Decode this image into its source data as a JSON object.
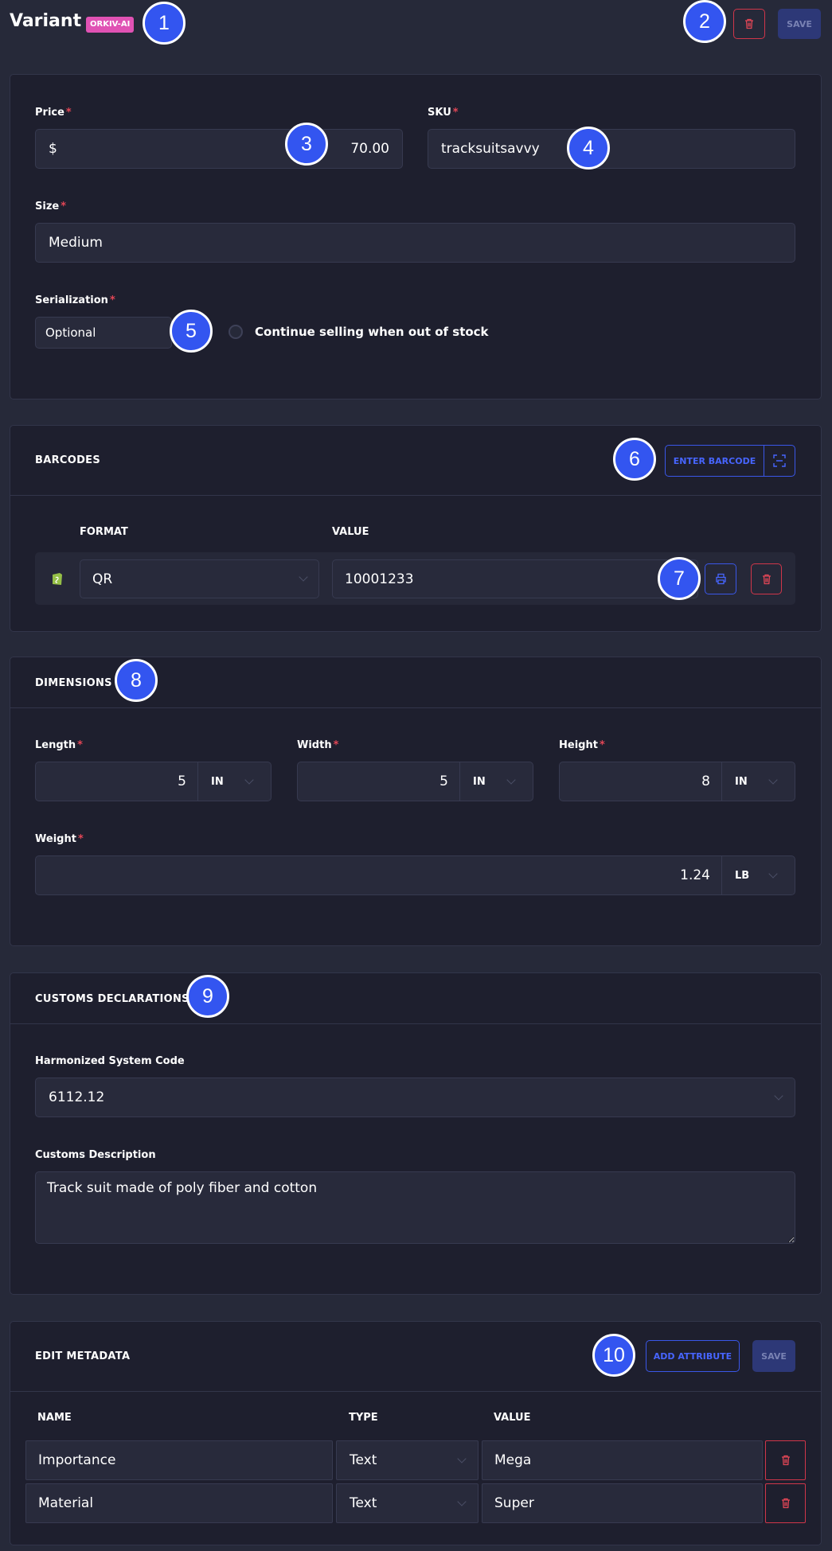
{
  "header": {
    "title": "Variant",
    "badge": "ORKIV-AI",
    "save_label": "SAVE"
  },
  "variant": {
    "price_label": "Price",
    "price_currency": "$",
    "price_value": "70.00",
    "sku_label": "SKU",
    "sku_value": "tracksuitsavvy",
    "size_label": "Size",
    "size_value": "Medium",
    "serialization_label": "Serialization",
    "serialization_value": "Optional",
    "continue_selling_label": "Continue selling when out of stock",
    "required_mark": "*"
  },
  "barcodes": {
    "title": "BARCODES",
    "enter_barcode_label": "ENTER BARCODE",
    "format_header": "FORMAT",
    "value_header": "VALUE",
    "rows": [
      {
        "format": "QR",
        "value": "10001233"
      }
    ]
  },
  "dimensions": {
    "title": "DIMENSIONS",
    "length_label": "Length",
    "length_value": "5",
    "length_unit": "IN",
    "width_label": "Width",
    "width_value": "5",
    "width_unit": "IN",
    "height_label": "Height",
    "height_value": "8",
    "height_unit": "IN",
    "weight_label": "Weight",
    "weight_value": "1.24",
    "weight_unit": "LB"
  },
  "customs": {
    "title": "CUSTOMS DECLARATIONS",
    "hs_code_label": "Harmonized System Code",
    "hs_code_value": "6112.12",
    "description_label": "Customs Description",
    "description_value": "Track suit made of poly fiber and cotton"
  },
  "metadata": {
    "title": "EDIT METADATA",
    "add_attribute_label": "ADD ATTRIBUTE",
    "save_label": "SAVE",
    "name_header": "NAME",
    "type_header": "TYPE",
    "value_header": "VALUE",
    "rows": [
      {
        "name": "Importance",
        "type": "Text",
        "value": "Mega"
      },
      {
        "name": "Material",
        "type": "Text",
        "value": "Super"
      }
    ]
  },
  "markers": [
    "1",
    "2",
    "3",
    "4",
    "5",
    "6",
    "7",
    "8",
    "9",
    "10"
  ],
  "colors": {
    "accent": "#3a57e8",
    "danger": "#e34656",
    "badge": "#e052b4",
    "card": "#1e1f2e",
    "page": "#262939"
  }
}
